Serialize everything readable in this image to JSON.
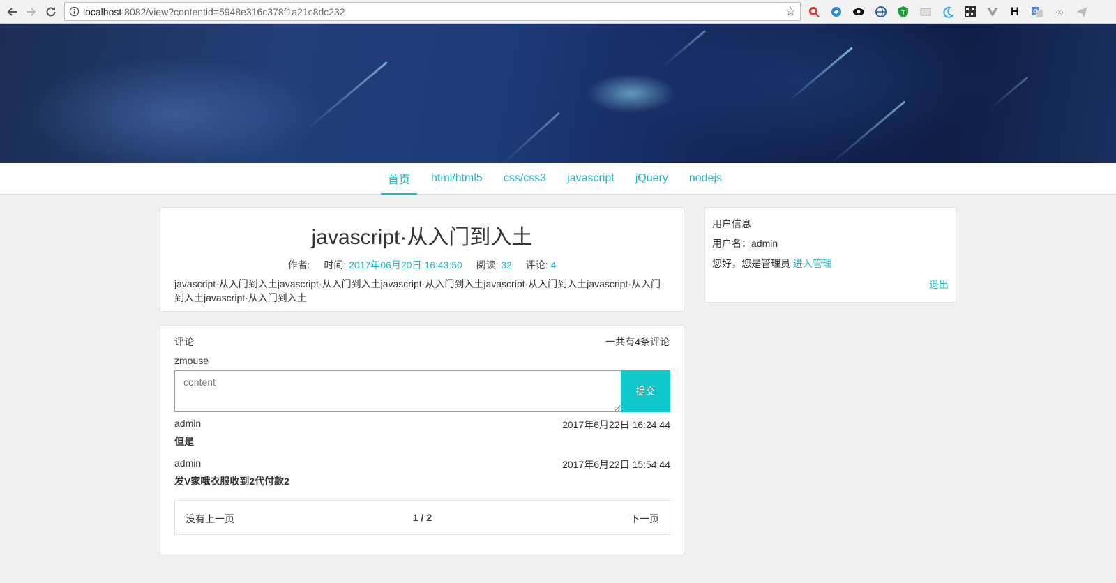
{
  "browser": {
    "url_host": "localhost",
    "url_rest": ":8082/view?contentid=5948e316c378f1a21c8dc232",
    "extensions": [
      "search-ext-icon",
      "bird-ext-icon",
      "eye-ext-icon",
      "globe-ext-icon",
      "shield-ext-icon",
      "page-ext-icon",
      "moon-ext-icon",
      "qr-ext-icon",
      "vue-ext-icon",
      "h-ext-icon",
      "translate-ext-icon",
      "json-ext-icon",
      "plane-ext-icon"
    ],
    "ext_h_label": "H",
    "ext_json_label": "{x}"
  },
  "nav": {
    "items": [
      {
        "label": "首页",
        "active": true
      },
      {
        "label": "html/html5"
      },
      {
        "label": "css/css3"
      },
      {
        "label": "javascript"
      },
      {
        "label": "jQuery"
      },
      {
        "label": "nodejs"
      }
    ]
  },
  "article": {
    "title": "javascript·从入门到入土",
    "author_label": "作者:",
    "author_value": "",
    "time_label": "时间:",
    "time_value": "2017年06月20日 16:43:50",
    "read_label": "阅读:",
    "read_value": "32",
    "comment_label": "评论:",
    "comment_value": "4",
    "body": "javascript·从入门到入土javascript·从入门到入土javascript·从入门到入土javascript·从入门到入土javascript·从入门到入土javascript·从入门到入土"
  },
  "comments": {
    "heading": "评论",
    "total": "一共有4条评论",
    "current_user": "zmouse",
    "placeholder": "content",
    "submit_label": "提交",
    "items": [
      {
        "author": "admin",
        "time": "2017年6月22日 16:24:44",
        "text": "但是"
      },
      {
        "author": "admin",
        "time": "2017年6月22日 15:54:44",
        "text": "发V家哦衣服收到2代付款2"
      }
    ],
    "pager": {
      "prev": "没有上一页",
      "page": "1 / 2",
      "next": "下一页"
    }
  },
  "userinfo": {
    "title": "用户信息",
    "username_line": "用户名：admin",
    "greeting": "您好，您是管理员",
    "manage_link": "进入管理",
    "logout": "退出"
  },
  "colors": {
    "accent": "#1fb8c6",
    "submit": "#10c8cc"
  }
}
